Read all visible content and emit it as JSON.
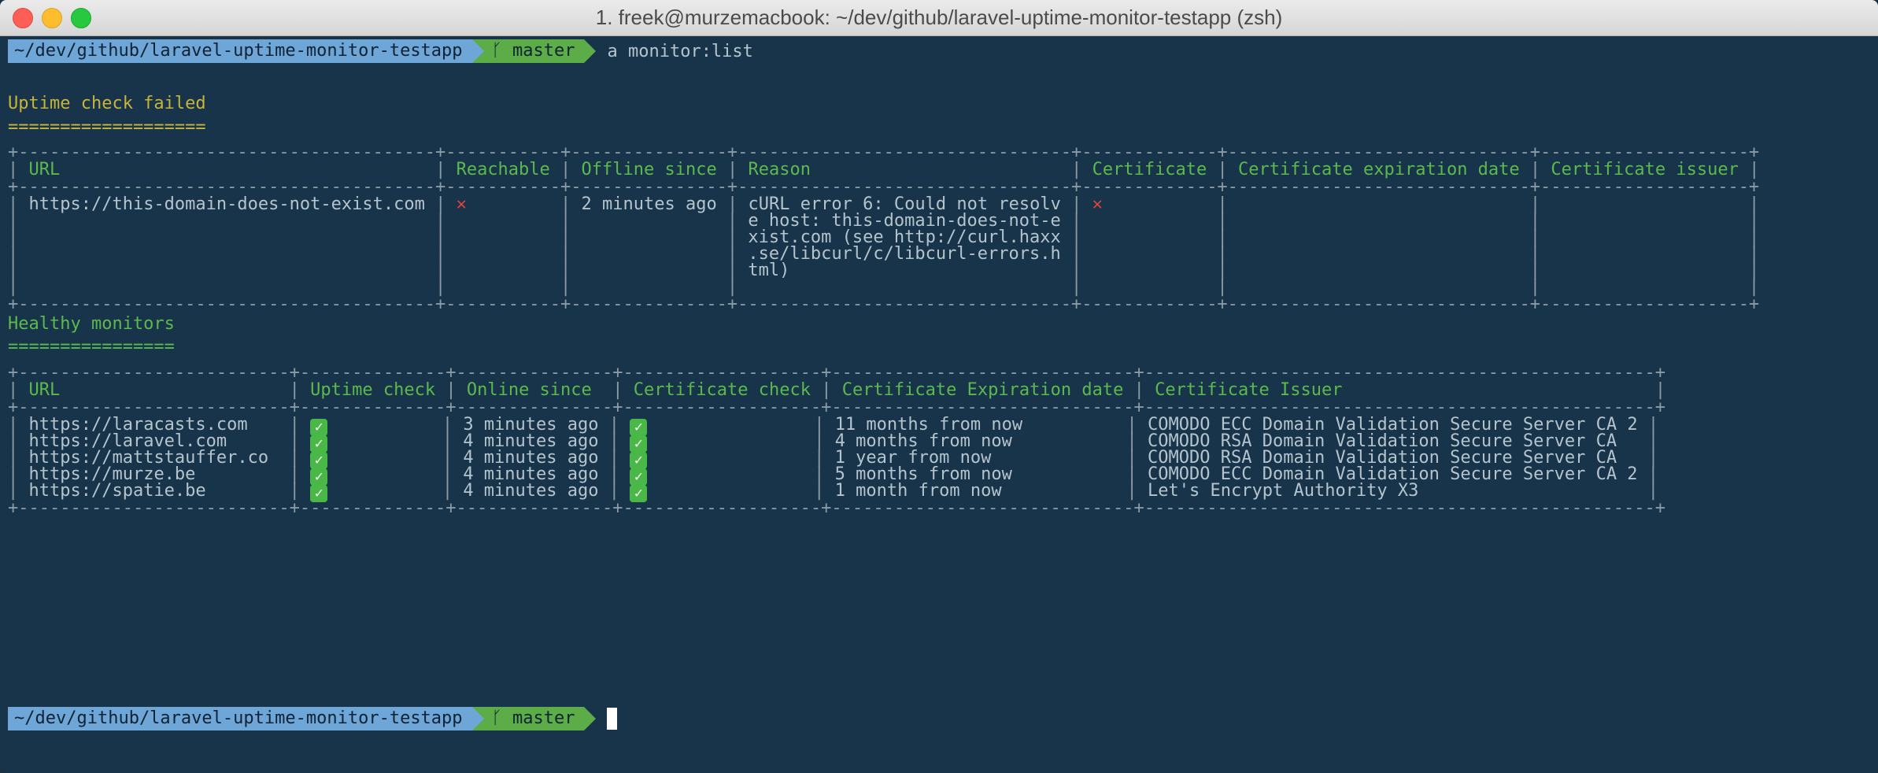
{
  "window": {
    "title": "1. freek@murzemacbook: ~/dev/github/laravel-uptime-monitor-testapp (zsh)"
  },
  "prompt": {
    "path": "~/dev/github/laravel-uptime-monitor-testapp",
    "branch": "master",
    "branch_glyph": "ᚴ",
    "command": "a monitor:list"
  },
  "failed": {
    "title": "Uptime check failed",
    "underline": "===================",
    "headers": [
      "URL",
      "Reachable",
      "Offline since",
      "Reason",
      "Certificate",
      "Certificate expiration date",
      "Certificate issuer"
    ],
    "row": {
      "url": "https://this-domain-does-not-exist.com",
      "reachable": "✕",
      "offline_since": "2 minutes ago",
      "reason_lines": [
        "cURL error 6: Could not resolv",
        "e host: this-domain-does-not-e",
        "xist.com (see http://curl.haxx",
        ".se/libcurl/c/libcurl-errors.h",
        "tml)"
      ],
      "certificate": "✕"
    }
  },
  "healthy": {
    "title": "Healthy monitors",
    "underline": "================",
    "headers": [
      "URL",
      "Uptime check",
      "Online since",
      "Certificate check",
      "Certificate Expiration date",
      "Certificate Issuer"
    ],
    "rows": [
      {
        "url": "https://laracasts.com",
        "uptime": "✓",
        "online_since": "3 minutes ago",
        "cert": "✓",
        "expiration": "11 months from now",
        "issuer": "COMODO ECC Domain Validation Secure Server CA 2"
      },
      {
        "url": "https://laravel.com",
        "uptime": "✓",
        "online_since": "4 minutes ago",
        "cert": "✓",
        "expiration": "4 months from now",
        "issuer": "COMODO RSA Domain Validation Secure Server CA"
      },
      {
        "url": "https://mattstauffer.co",
        "uptime": "✓",
        "online_since": "4 minutes ago",
        "cert": "✓",
        "expiration": "1 year from now",
        "issuer": "COMODO RSA Domain Validation Secure Server CA"
      },
      {
        "url": "https://murze.be",
        "uptime": "✓",
        "online_since": "4 minutes ago",
        "cert": "✓",
        "expiration": "5 months from now",
        "issuer": "COMODO ECC Domain Validation Secure Server CA 2"
      },
      {
        "url": "https://spatie.be",
        "uptime": "✓",
        "online_since": "4 minutes ago",
        "cert": "✓",
        "expiration": "1 month from now",
        "issuer": "Let's Encrypt Authority X3"
      }
    ]
  },
  "colors": {
    "background": "#17344a",
    "heading_yellow": "#c8b43a",
    "heading_green": "#5cb94e",
    "path_segment": "#6ea6d8",
    "branch_segment": "#5cad47",
    "error_red": "#e0433a"
  }
}
